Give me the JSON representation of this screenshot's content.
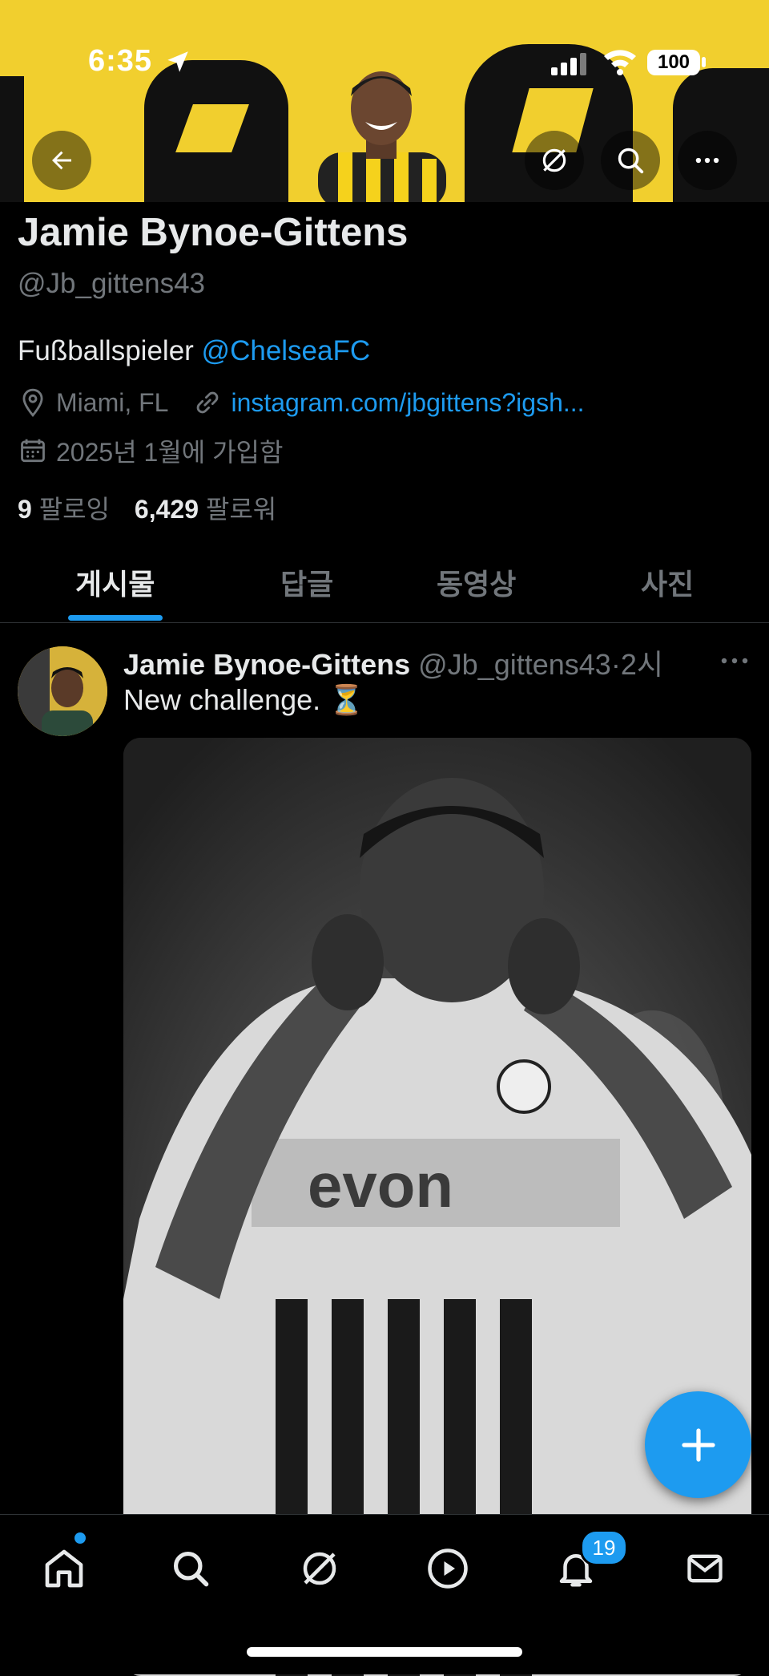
{
  "status": {
    "time": "6:35",
    "battery": "100"
  },
  "profile": {
    "name": "Jamie Bynoe-Gittens",
    "handle": "@Jb_gittens43",
    "bio_text": "Fußballspieler ",
    "bio_mention": "@ChelseaFC",
    "location": "Miami, FL",
    "link": "instagram.com/jbgittens?igsh...",
    "joined": "2025년 1월에 가입함",
    "following_count": "9",
    "following_label": "팔로잉",
    "followers_count": "6,429",
    "followers_label": "팔로워"
  },
  "tabs": [
    {
      "label": "게시물",
      "active": true
    },
    {
      "label": "답글",
      "active": false
    },
    {
      "label": "동영상",
      "active": false
    },
    {
      "label": "사진",
      "active": false
    }
  ],
  "post": {
    "author_name": "Jamie Bynoe-Gittens",
    "author_handle": "@Jb_gittens43",
    "time": "2시",
    "text": "New challenge. ⏳"
  },
  "nav": {
    "notifications_badge": "19"
  },
  "colors": {
    "accent": "#1d9bf0",
    "banner": "#f1cf2e",
    "background": "#000000",
    "secondary_text": "#71767b"
  },
  "icons": [
    "back-arrow-icon",
    "grok-icon",
    "search-icon",
    "more-icon",
    "location-icon",
    "link-icon",
    "calendar-icon",
    "home-icon",
    "play-icon",
    "bell-icon",
    "mail-icon",
    "plus-icon"
  ]
}
